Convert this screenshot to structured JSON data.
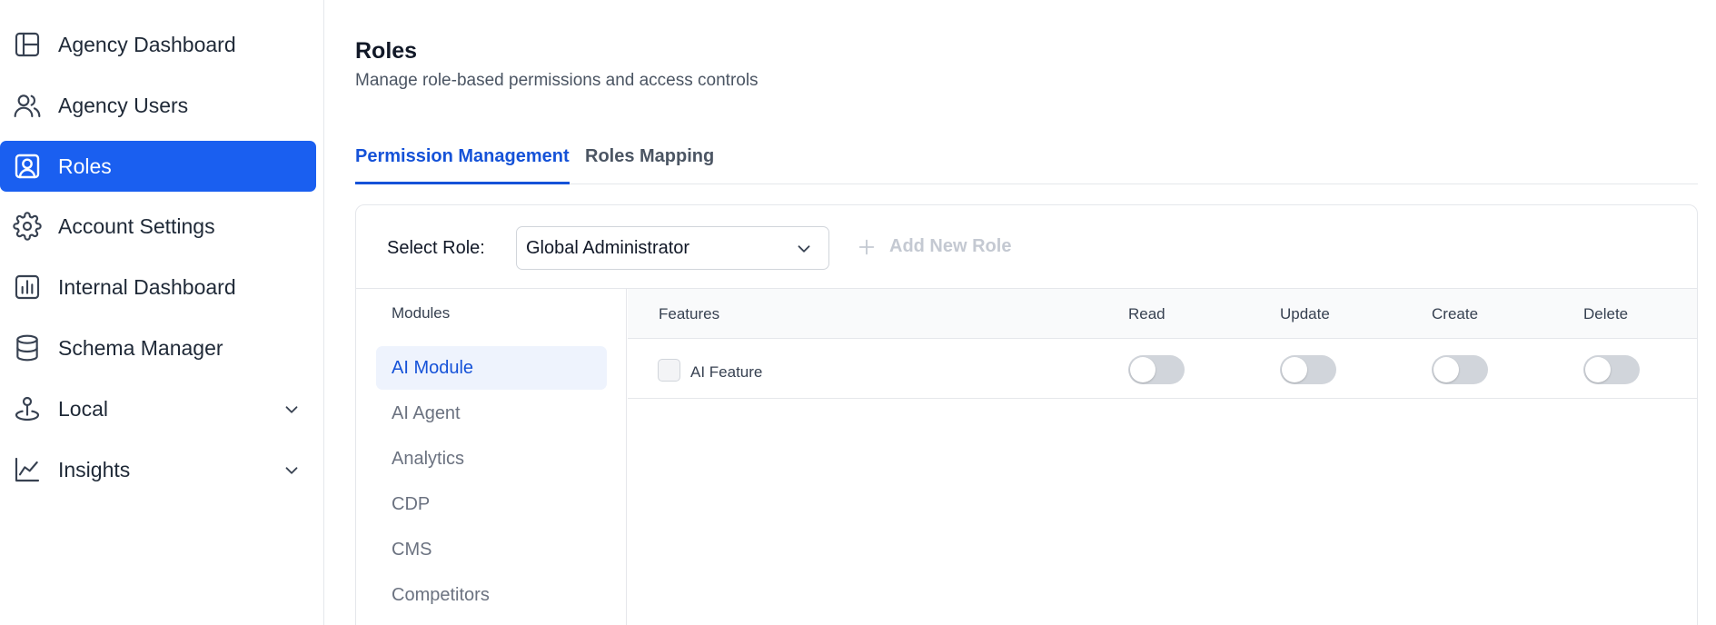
{
  "sidebar": {
    "items": [
      {
        "label": "Agency Dashboard",
        "icon": "layout-icon"
      },
      {
        "label": "Agency Users",
        "icon": "users-icon"
      },
      {
        "label": "Roles",
        "icon": "user-square-icon",
        "active": true
      },
      {
        "label": "Account Settings",
        "icon": "gear-icon"
      },
      {
        "label": "Internal Dashboard",
        "icon": "bar-chart-icon"
      },
      {
        "label": "Schema Manager",
        "icon": "database-icon"
      },
      {
        "label": "Local",
        "icon": "map-pin-icon",
        "expandable": true
      },
      {
        "label": "Insights",
        "icon": "line-chart-icon",
        "expandable": true
      }
    ]
  },
  "page": {
    "title": "Roles",
    "subtitle": "Manage role-based permissions and access controls"
  },
  "tabs": [
    {
      "label": "Permission Management",
      "active": true
    },
    {
      "label": "Roles Mapping",
      "active": false
    }
  ],
  "role_selector": {
    "label": "Select Role:",
    "selected": "Global Administrator",
    "add_label": "Add New Role"
  },
  "modules": {
    "header": "Modules",
    "items": [
      "AI Module",
      "AI Agent",
      "Analytics",
      "CDP",
      "CMS",
      "Competitors"
    ],
    "active_index": 0
  },
  "features": {
    "headers": [
      "Features",
      "Read",
      "Update",
      "Create",
      "Delete"
    ],
    "rows": [
      {
        "name": "AI Feature",
        "checked": false,
        "read": false,
        "update": false,
        "create": false,
        "delete": false
      }
    ]
  },
  "colors": {
    "accent": "#1a5ff0",
    "tab_active": "#1552d8",
    "module_active_bg": "#eef3fd",
    "toggle_off": "#d1d5db"
  }
}
